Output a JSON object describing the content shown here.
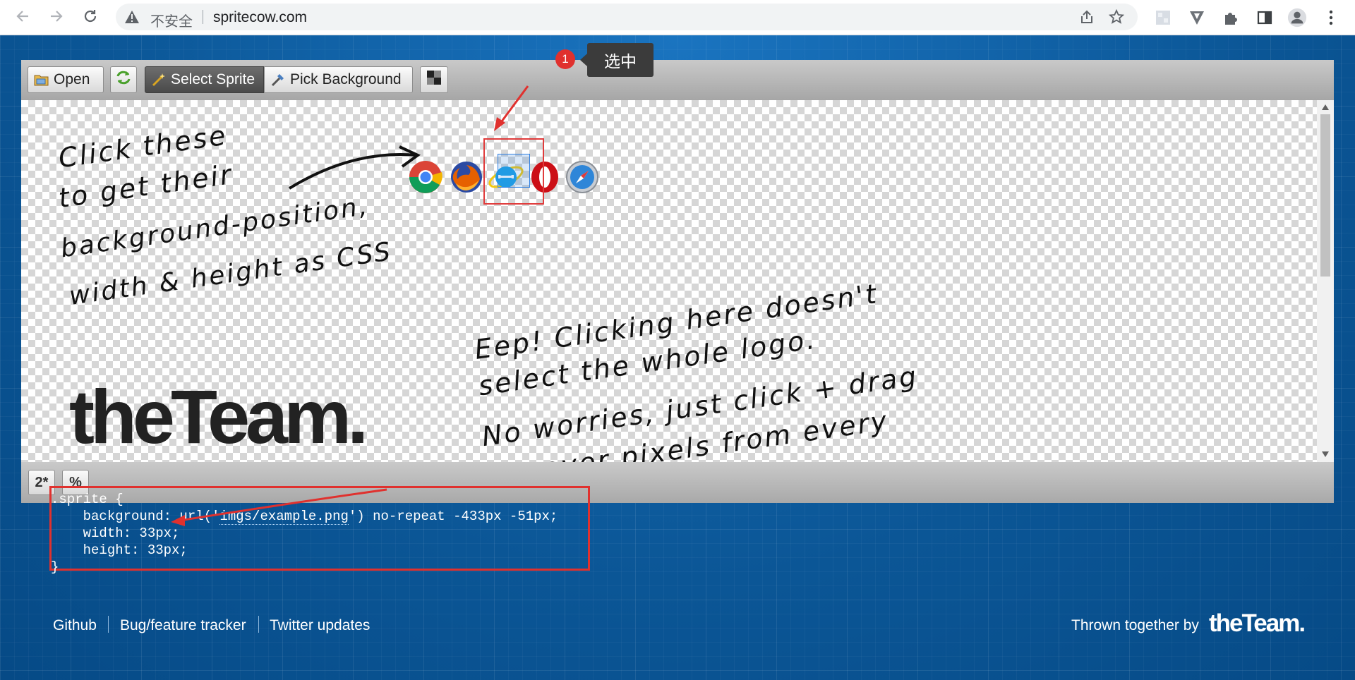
{
  "browser": {
    "insecure_label": "不安全",
    "url": "spritecow.com",
    "icons": [
      "back-arrow-icon",
      "forward-arrow-icon",
      "reload-icon",
      "warning-icon",
      "share-icon",
      "bookmark-star-icon",
      "extension-tile-icon",
      "extension-v-icon",
      "puzzle-icon",
      "side-panel-icon",
      "profile-icon",
      "kebab-menu-icon"
    ]
  },
  "toolbar": {
    "open_label": "Open",
    "select_sprite_label": "Select Sprite",
    "pick_background_label": "Pick Background"
  },
  "canvas": {
    "handwriting_left": [
      "Click these",
      "to get their",
      "background-position,",
      "width & height as CSS"
    ],
    "handwriting_right": [
      "Eep! Clicking here doesn't",
      "select the whole logo.",
      "No worries, just click + drag",
      "to cover pixels from every"
    ],
    "logo_text": "theTeam.",
    "sprites": [
      "chrome-logo-icon",
      "firefox-logo-icon",
      "ie-logo-icon",
      "opera-logo-icon",
      "safari-logo-icon"
    ]
  },
  "annotation": {
    "badge_number": "1",
    "tooltip_text": "选中",
    "accent_color": "#e0312e"
  },
  "bottom_buttons": {
    "zoom_label": "2*",
    "percent_label": "%"
  },
  "css_output": {
    "line1": ".sprite {",
    "line2_prefix": "    background: url('",
    "line2_url": "imgs/example.png",
    "line2_suffix": "') no-repeat -433px -51px;",
    "line3": "    width: 33px;",
    "line4": "    height: 33px;",
    "line5": "}"
  },
  "footer": {
    "links": [
      "Github",
      "Bug/feature tracker",
      "Twitter updates"
    ],
    "credit": "Thrown together by",
    "logo": "theTeam."
  }
}
